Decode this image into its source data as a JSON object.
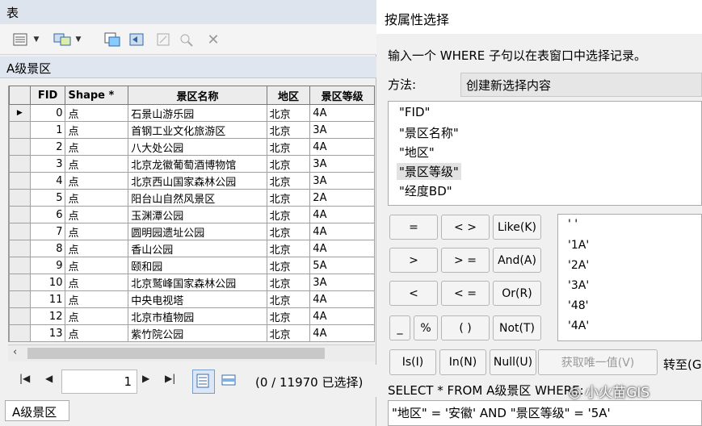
{
  "table_window": {
    "title": "表",
    "tab_title": "A级景区",
    "columns": [
      "FID",
      "Shape *",
      "景区名称",
      "地区",
      "景区等级"
    ],
    "rows": [
      [
        "0",
        "点",
        "石景山游乐园",
        "北京",
        "4A"
      ],
      [
        "1",
        "点",
        "首钢工业文化旅游区",
        "北京",
        "3A"
      ],
      [
        "2",
        "点",
        "八大处公园",
        "北京",
        "4A"
      ],
      [
        "3",
        "点",
        "北京龙徽葡萄酒博物馆",
        "北京",
        "3A"
      ],
      [
        "4",
        "点",
        "北京西山国家森林公园",
        "北京",
        "3A"
      ],
      [
        "5",
        "点",
        "阳台山自然风景区",
        "北京",
        "2A"
      ],
      [
        "6",
        "点",
        "玉渊潭公园",
        "北京",
        "4A"
      ],
      [
        "7",
        "点",
        "圆明园遗址公园",
        "北京",
        "4A"
      ],
      [
        "8",
        "点",
        "香山公园",
        "北京",
        "4A"
      ],
      [
        "9",
        "点",
        "颐和园",
        "北京",
        "5A"
      ],
      [
        "10",
        "点",
        "北京鹫峰国家森林公园",
        "北京",
        "3A"
      ],
      [
        "11",
        "点",
        "中央电视塔",
        "北京",
        "4A"
      ],
      [
        "12",
        "点",
        "北京市植物园",
        "北京",
        "4A"
      ],
      [
        "13",
        "点",
        "紫竹院公园",
        "北京",
        "4A"
      ]
    ],
    "page_number": "1",
    "status": "(0 / 11970 已选择)",
    "bottom_tab": "A级景区"
  },
  "dialog": {
    "title": "按属性选择",
    "prompt": "输入一个 WHERE 子句以在表窗口中选择记录。",
    "method_label": "方法:",
    "method_value": "创建新选择内容",
    "fields": [
      "\"FID\"",
      "\"景区名称\"",
      "\"地区\"",
      "\"景区等级\"",
      "\"经度BD\""
    ],
    "selected_field_index": 3,
    "operators": {
      "eq": "=",
      "ne": "< >",
      "like": "Like(K)",
      "gt": ">",
      "ge": "> =",
      "and": "And(A)",
      "lt": "<",
      "le": "< =",
      "or": "Or(R)",
      "underscore": "_",
      "percent": "%",
      "parens": "( )",
      "not": "Not(T)"
    },
    "buttons": {
      "is": "Is(I)",
      "in": "In(N)",
      "null": "Null(U)",
      "get_unique": "获取唯一值(V)"
    },
    "convert_label": "转至(G",
    "values": [
      "' '",
      "'1A'",
      "'2A'",
      "'3A'",
      "'48'",
      "'4A'"
    ],
    "sql_header": "SELECT * FROM A级景区 WHERE:",
    "sql_text": "\"地区\" = '安徽' AND \"景区等级\" = '5A'",
    "watermark": "小火苗GIS"
  }
}
